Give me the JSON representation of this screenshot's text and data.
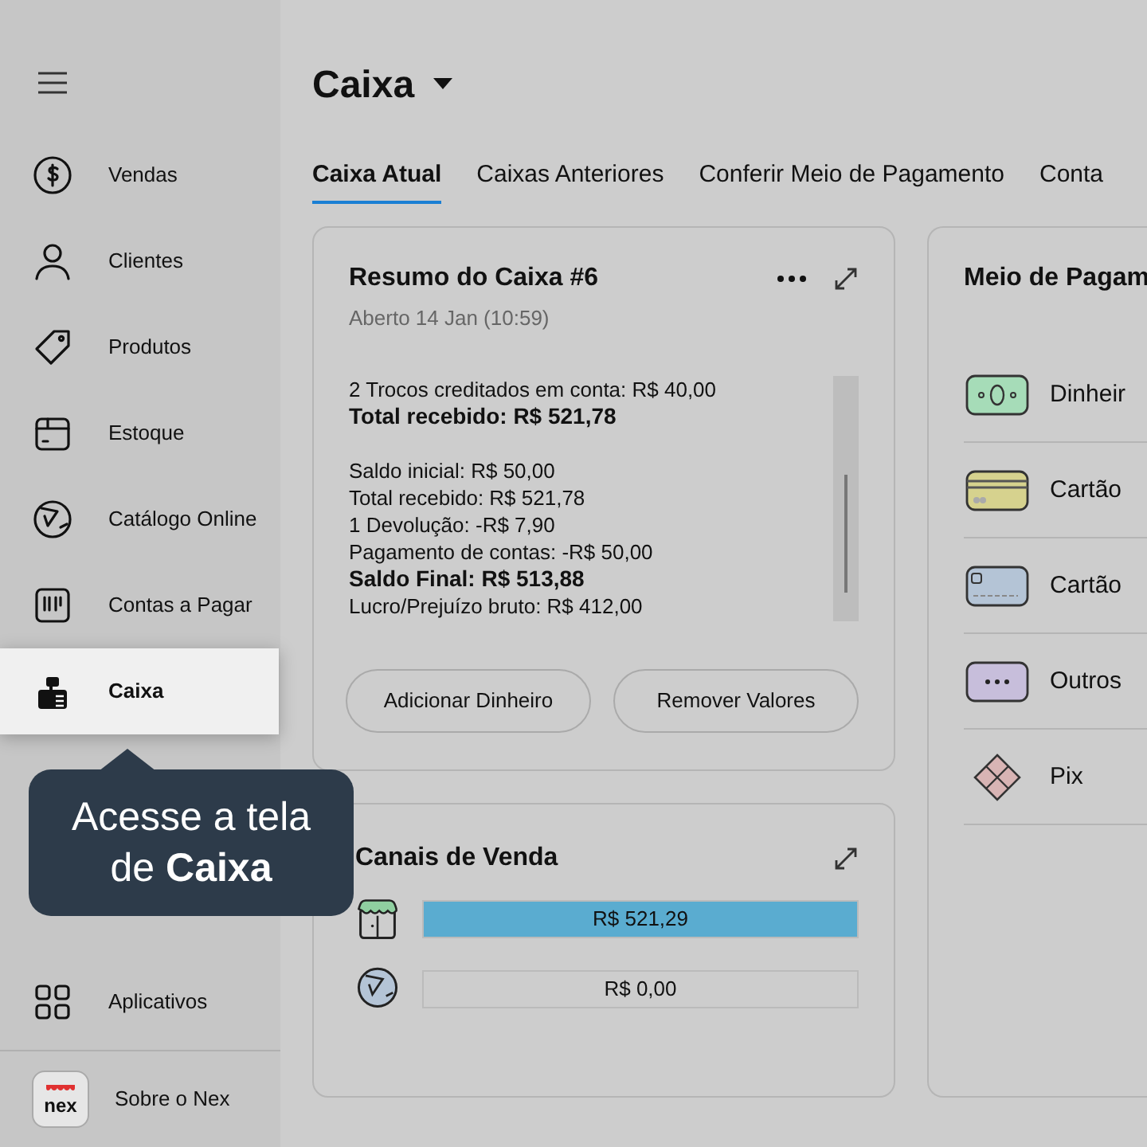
{
  "sidebar": {
    "items": [
      {
        "label": "Vendas",
        "selected": false
      },
      {
        "label": "Clientes",
        "selected": false
      },
      {
        "label": "Produtos",
        "selected": false
      },
      {
        "label": "Estoque",
        "selected": false
      },
      {
        "label": "Catálogo Online",
        "selected": false
      },
      {
        "label": "Contas a Pagar",
        "selected": false
      },
      {
        "label": "Caixa",
        "selected": true
      }
    ],
    "bottom": [
      {
        "label": "Aplicativos"
      },
      {
        "label": "Sobre o Nex",
        "logo": "nex"
      }
    ]
  },
  "tooltip": {
    "text": "Acesse a tela de **Caixa**"
  },
  "page": {
    "title": "Caixa"
  },
  "tabs": [
    {
      "label": "Caixa Atual",
      "selected": true
    },
    {
      "label": "Caixas Anteriores",
      "selected": false
    },
    {
      "label": "Conferir Meio de Pagamento",
      "selected": false
    },
    {
      "label": "Conta",
      "selected": false
    }
  ],
  "summary": {
    "title": "Resumo do Caixa #6",
    "subtitle": "Aberto 14 Jan (10:59)",
    "lines": [
      {
        "text": "2 Trocos creditados em conta: R$ 40,00",
        "kind": "line"
      },
      {
        "text": "Total recebido: R$ 521,78",
        "kind": "total"
      },
      {
        "text": "Saldo inicial: R$ 50,00",
        "kind": "group-start"
      },
      {
        "text": "Total recebido: R$ 521,78",
        "kind": "line"
      },
      {
        "text": "1 Devolução: -R$ 7,90",
        "kind": "line"
      },
      {
        "text": "Pagamento de contas: -R$ 50,00",
        "kind": "line"
      },
      {
        "text": "Saldo Final: R$ 513,88",
        "kind": "total"
      },
      {
        "text": "Lucro/Prejuízo bruto: R$ 412,00",
        "kind": "line"
      }
    ],
    "buttons": [
      "Adicionar Dinheiro",
      "Remover Valores"
    ]
  },
  "channels": {
    "title": "Canais de Venda",
    "items": [
      {
        "value": "R$ 521,29",
        "level": 1
      },
      {
        "value": "R$ 0,00",
        "level": 0
      }
    ]
  },
  "payments": {
    "title": "Meio de Pagam",
    "items": [
      {
        "label": "Dinheir"
      },
      {
        "label": "Cartão"
      },
      {
        "label": "Cartão"
      },
      {
        "label": "Outros"
      },
      {
        "label": "Pix"
      }
    ]
  }
}
